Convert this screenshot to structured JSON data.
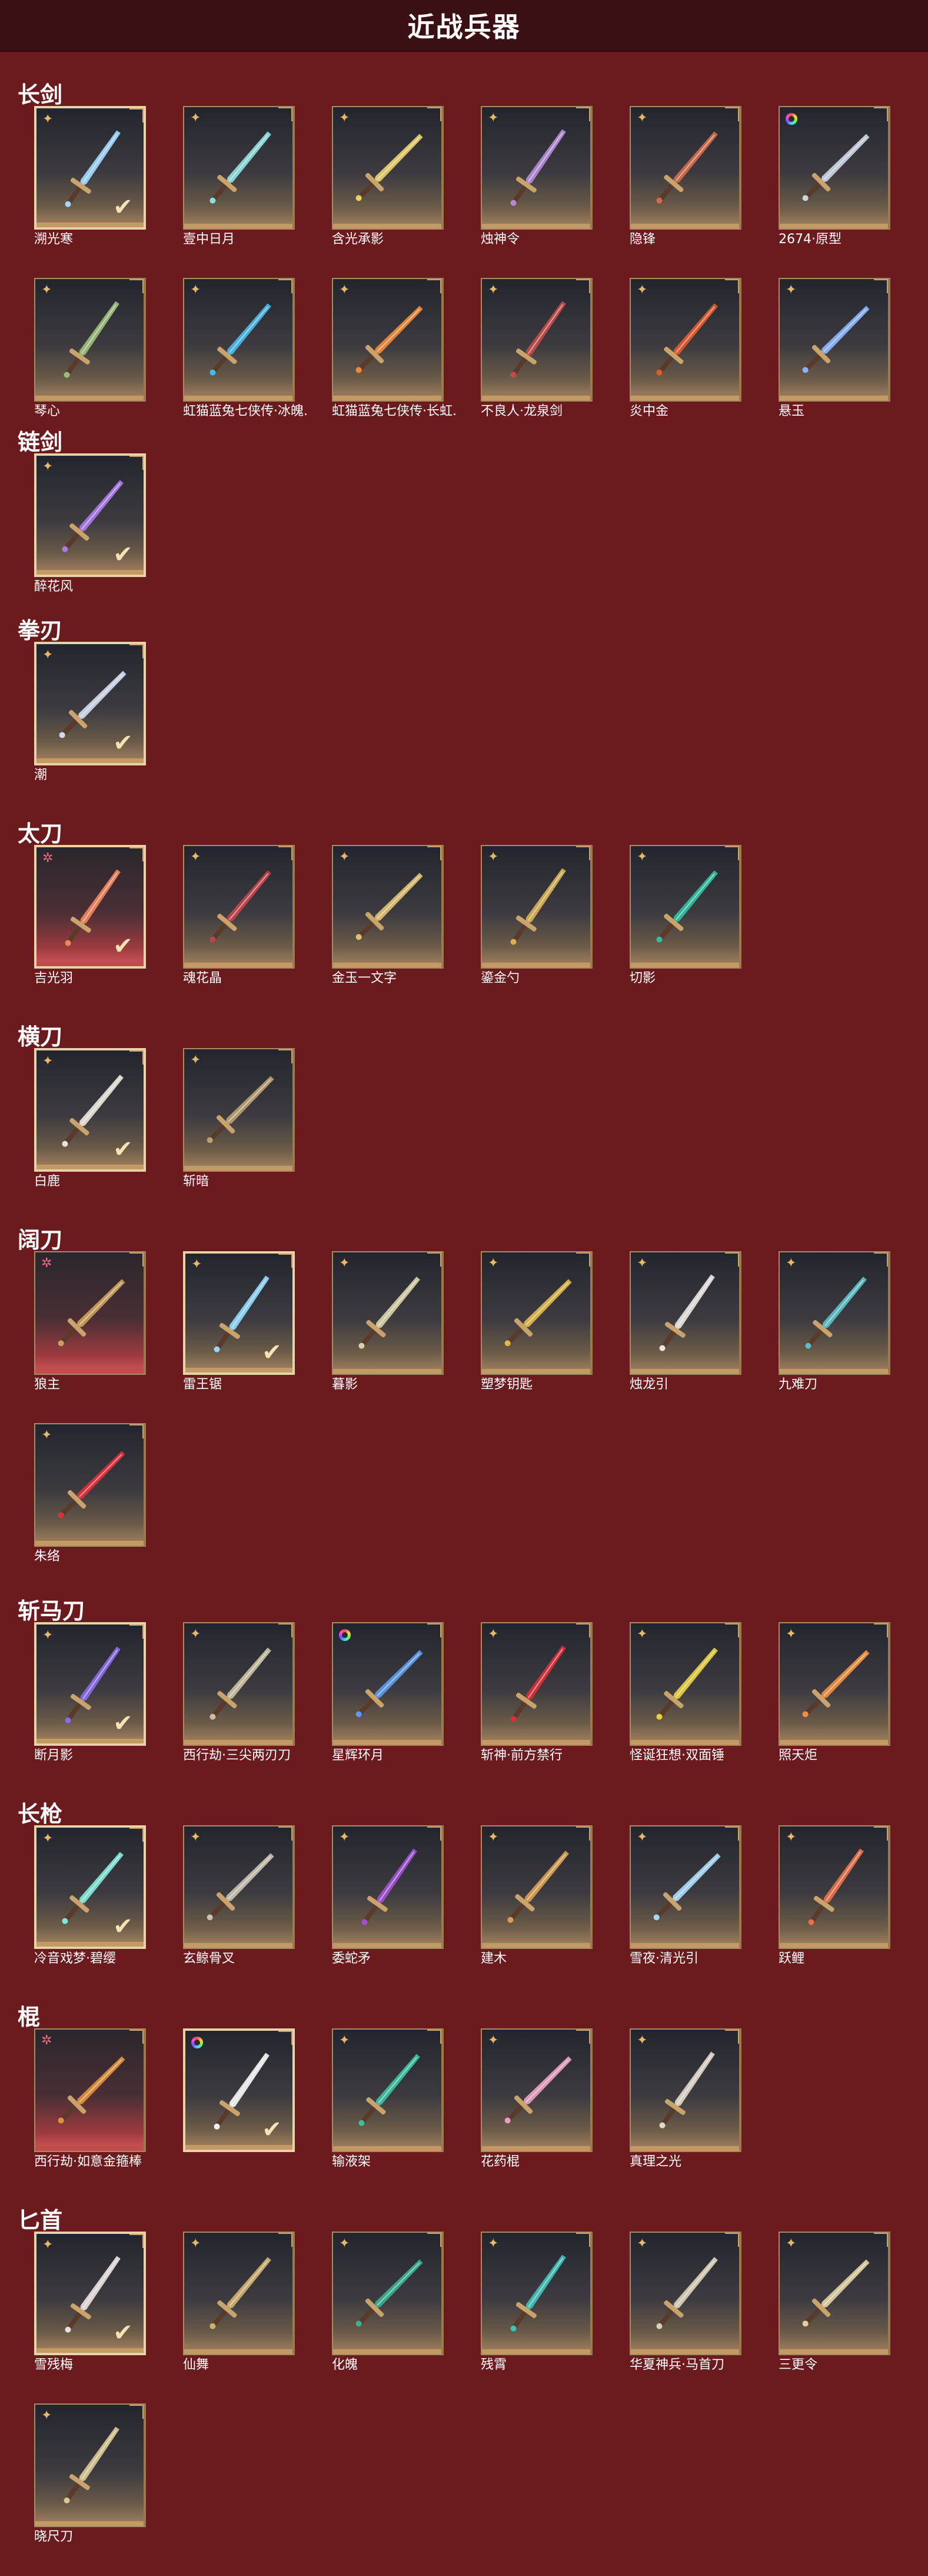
{
  "page": {
    "title": "近战兵器"
  },
  "colors": {
    "background": "#6b1a1e",
    "header": "#3a1014",
    "frame_gold": "#c49a64",
    "frame_red": "#c24b4b",
    "check": "#f6e2b4"
  },
  "categories": [
    {
      "name": "长剑",
      "items": [
        {
          "label": "溯光寒",
          "rank": "gold-star-icon",
          "selected": true,
          "color": "#9fd7ff"
        },
        {
          "label": "壹中日月",
          "rank": "gold-star-icon",
          "selected": false,
          "color": "#8ee0dc"
        },
        {
          "label": "含光承影",
          "rank": "gold-star-icon",
          "selected": false,
          "color": "#e7d06a"
        },
        {
          "label": "烛神令",
          "rank": "gold-star-icon",
          "selected": false,
          "color": "#b58ad8"
        },
        {
          "label": "隐锋",
          "rank": "gold-star-icon",
          "selected": false,
          "color": "#d06a4a"
        },
        {
          "label": "2674·原型",
          "rank": "rainbow-icon",
          "selected": false,
          "color": "#c9d3e0"
        },
        {
          "label": "琴心",
          "rank": "gold-star-icon",
          "selected": false,
          "color": "#9bbd7a"
        },
        {
          "label": "虹猫蓝兔七侠传·冰魄...",
          "rank": "gold-star-icon",
          "selected": false,
          "color": "#4ab8e8"
        },
        {
          "label": "虹猫蓝兔七侠传·长虹...",
          "rank": "gold-star-icon",
          "selected": false,
          "color": "#f08a3a"
        },
        {
          "label": "不良人·龙泉剑",
          "rank": "gold-star-icon",
          "selected": false,
          "color": "#c24b4b"
        },
        {
          "label": "炎中金",
          "rank": "gold-star-icon",
          "selected": false,
          "color": "#e05a2a"
        },
        {
          "label": "悬玉",
          "rank": "gold-star-icon",
          "selected": false,
          "color": "#8ab4ff"
        }
      ]
    },
    {
      "name": "链剑",
      "items": [
        {
          "label": "醉花风",
          "rank": "gold-star-icon",
          "selected": true,
          "color": "#a97ae8"
        }
      ]
    },
    {
      "name": "拳刃",
      "items": [
        {
          "label": "潮",
          "rank": "gold-star-icon",
          "selected": true,
          "color": "#cfd9f0"
        }
      ]
    },
    {
      "name": "太刀",
      "items": [
        {
          "label": "吉光羽",
          "rank": "pink-star-icon",
          "selected": true,
          "color": "#f0845a",
          "red": true
        },
        {
          "label": "魂花晶",
          "rank": "gold-star-icon",
          "selected": false,
          "color": "#c2444a"
        },
        {
          "label": "金玉一文字",
          "rank": "gold-star-icon",
          "selected": false,
          "color": "#e0c070"
        },
        {
          "label": "鎏金勺",
          "rank": "gold-star-icon",
          "selected": false,
          "color": "#d8b054"
        },
        {
          "label": "切影",
          "rank": "gold-star-icon",
          "selected": false,
          "color": "#2fbf9e"
        }
      ]
    },
    {
      "name": "横刀",
      "items": [
        {
          "label": "白鹿",
          "rank": "gold-star-icon",
          "selected": true,
          "color": "#e8e4d8"
        },
        {
          "label": "斩暗",
          "rank": "gold-star-icon",
          "selected": false,
          "color": "#b8a070"
        }
      ]
    },
    {
      "name": "阔刀",
      "items": [
        {
          "label": "狼主",
          "rank": "pink-star-icon",
          "selected": false,
          "color": "#c9a15a",
          "red": true
        },
        {
          "label": "雷王锯",
          "rank": "gold-star-icon",
          "selected": true,
          "color": "#8fd8ff"
        },
        {
          "label": "暮影",
          "rank": "gold-star-icon",
          "selected": false,
          "color": "#d8d0a8"
        },
        {
          "label": "塑梦钥匙",
          "rank": "gold-star-icon",
          "selected": false,
          "color": "#e0b84a"
        },
        {
          "label": "烛龙引",
          "rank": "gold-star-icon",
          "selected": false,
          "color": "#e8e4e0"
        },
        {
          "label": "九难刀",
          "rank": "gold-star-icon",
          "selected": false,
          "color": "#5ac0c8"
        },
        {
          "label": "朱络",
          "rank": "gold-star-icon",
          "selected": false,
          "color": "#e0303a"
        }
      ]
    },
    {
      "name": "斩马刀",
      "items": [
        {
          "label": "断月影",
          "rank": "gold-star-icon",
          "selected": true,
          "color": "#8a6ae8"
        },
        {
          "label": "西行劫·三尖两刃刀",
          "rank": "gold-star-icon",
          "selected": false,
          "color": "#c9c0a0"
        },
        {
          "label": "星辉环月",
          "rank": "rainbow-icon",
          "selected": false,
          "color": "#5a9ae8"
        },
        {
          "label": "斩神·前方禁行",
          "rank": "gold-star-icon",
          "selected": false,
          "color": "#d8303a"
        },
        {
          "label": "怪诞狂想·双面锤",
          "rank": "gold-star-icon",
          "selected": false,
          "color": "#e8d040"
        },
        {
          "label": "照天炬",
          "rank": "gold-star-icon",
          "selected": false,
          "color": "#f09040"
        }
      ]
    },
    {
      "name": "长枪",
      "items": [
        {
          "label": "冷音戏梦·碧缨",
          "rank": "gold-star-icon",
          "selected": true,
          "color": "#7fe8d8"
        },
        {
          "label": "玄鲸骨叉",
          "rank": "gold-star-icon",
          "selected": false,
          "color": "#c8c0b0"
        },
        {
          "label": "委蛇矛",
          "rank": "gold-star-icon",
          "selected": false,
          "color": "#a050d0"
        },
        {
          "label": "建木",
          "rank": "gold-star-icon",
          "selected": false,
          "color": "#d8a050"
        },
        {
          "label": "雪夜·清光引",
          "rank": "gold-star-icon",
          "selected": false,
          "color": "#a8d8f8"
        },
        {
          "label": "跃鲤",
          "rank": "gold-star-icon",
          "selected": false,
          "color": "#e8704a"
        }
      ]
    },
    {
      "name": "棍",
      "items": [
        {
          "label": "西行劫·如意金箍棒",
          "rank": "pink-star-icon",
          "selected": false,
          "color": "#e09038",
          "red": true
        },
        {
          "label": "",
          "rank": "rainbow-icon",
          "selected": true,
          "color": "#f4f4f4"
        },
        {
          "label": "输液架",
          "rank": "gold-star-icon",
          "selected": false,
          "color": "#3ac0a0"
        },
        {
          "label": "花药棍",
          "rank": "gold-star-icon",
          "selected": false,
          "color": "#e8a0c0"
        },
        {
          "label": "真理之光",
          "rank": "gold-star-icon",
          "selected": false,
          "color": "#e0d8c8"
        }
      ]
    },
    {
      "name": "匕首",
      "items": [
        {
          "label": "雪残梅",
          "rank": "gold-star-icon",
          "selected": true,
          "color": "#e8e0e0"
        },
        {
          "label": "仙舞",
          "rank": "gold-star-icon",
          "selected": false,
          "color": "#d0b070"
        },
        {
          "label": "化魄",
          "rank": "gold-star-icon",
          "selected": false,
          "color": "#3ab090"
        },
        {
          "label": "残霄",
          "rank": "gold-star-icon",
          "selected": false,
          "color": "#40c0b8"
        },
        {
          "label": "华夏神兵·马首刀",
          "rank": "gold-star-icon",
          "selected": false,
          "color": "#d8d0b8"
        },
        {
          "label": "三更令",
          "rank": "gold-star-icon",
          "selected": false,
          "color": "#e0d0a0"
        },
        {
          "label": "晓尺刀",
          "rank": "gold-star-icon",
          "selected": false,
          "color": "#d8c890"
        }
      ]
    }
  ]
}
